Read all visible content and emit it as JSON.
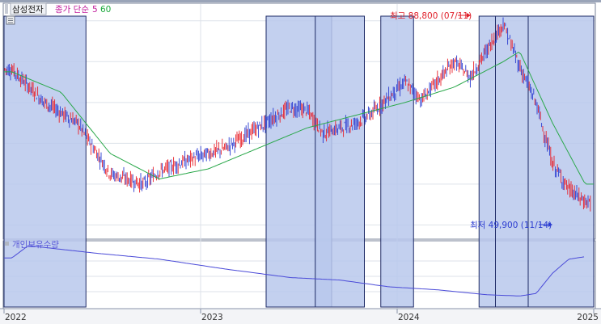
{
  "toolbar": {
    "symbol_label": "삼성전자",
    "ma_label": "종가 단순",
    "ma_short": "5",
    "ma_long": "60"
  },
  "annotations": {
    "high": "최고 88,800 (07/11)",
    "low": "최저 49,900 (11/14)"
  },
  "lower_panel": {
    "label": "개인보유수량"
  },
  "colors": {
    "candle_up": "#e8202a",
    "candle_down": "#2a3bd0",
    "ma_line": "#2aa84a",
    "holdings_line": "#4a4ad8",
    "highlight_fill": "#b8c8ec",
    "highlight_stroke": "#1e2a66",
    "grid": "#dde2ea",
    "symbol_color": "#1a1a1a",
    "ma_label_color": "#c0189a",
    "ma_short_color": "#c0189a",
    "ma_long_color": "#1aa83a"
  },
  "icons": {
    "settings": "small-grid-icon"
  },
  "chart_data": {
    "type": "line",
    "x_ticks": [
      "2022",
      "2023",
      "2024",
      "2025"
    ],
    "series": [
      {
        "name": "",
        "kind": "price_5d",
        "x": [
          "2022-01",
          "2022-03",
          "2022-05",
          "2022-07",
          "2022-09",
          "2022-10",
          "2022-12",
          "2023-02",
          "2023-04",
          "2023-06",
          "2023-07",
          "2023-08",
          "2023-10",
          "2023-11",
          "2024-01",
          "2024-02",
          "2024-04",
          "2024-05",
          "2024-07",
          "2024-08",
          "2024-09",
          "2024-10",
          "2024-11",
          "2024-12"
        ],
        "y": [
          78500,
          72000,
          68000,
          58000,
          56000,
          58500,
          61000,
          63000,
          67000,
          71000,
          70500,
          66000,
          68000,
          70000,
          76000,
          72500,
          80000,
          77000,
          87500,
          79000,
          72000,
          60000,
          55000,
          52500
        ]
      },
      {
        "name": "",
        "kind": "ma60",
        "x": [
          "2022-01",
          "2022-04",
          "2022-07",
          "2022-10",
          "2023-01",
          "2023-04",
          "2023-07",
          "2023-10",
          "2024-01",
          "2024-04",
          "2024-07",
          "2024-08",
          "2024-10",
          "2024-12"
        ],
        "y": [
          78000,
          74000,
          62000,
          57000,
          59000,
          63000,
          67000,
          69500,
          72000,
          75000,
          80000,
          82000,
          68000,
          56000
        ]
      },
      {
        "name": "개인보유수량",
        "kind": "holdings_index",
        "x": [
          "2022-01",
          "2022-02",
          "2022-06",
          "2022-10",
          "2023-02",
          "2023-06",
          "2023-09",
          "2023-12",
          "2024-03",
          "2024-06",
          "2024-08",
          "2024-09",
          "2024-10",
          "2024-11",
          "2024-12"
        ],
        "y": [
          80,
          100,
          88,
          78,
          62,
          48,
          44,
          33,
          28,
          20,
          18,
          22,
          55,
          78,
          82
        ]
      }
    ],
    "highlight_ranges": [
      [
        "2022-01",
        "2022-05"
      ],
      [
        "2023-05",
        "2023-08"
      ],
      [
        "2023-08",
        "2023-10"
      ],
      [
        "2023-12",
        "2024-01"
      ],
      [
        "2024-06",
        "2024-06"
      ],
      [
        "2024-07",
        "2024-08"
      ],
      [
        "2024-09",
        "2024-12"
      ]
    ],
    "high_point": {
      "x": "2024-07",
      "y": 88800
    },
    "low_point": {
      "x": "2024-11",
      "y": 49900
    }
  }
}
